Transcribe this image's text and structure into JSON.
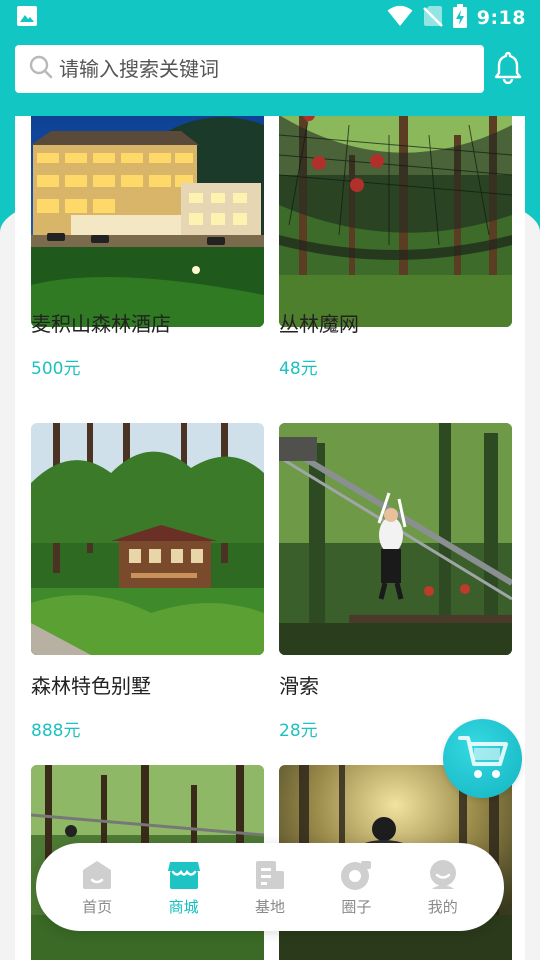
{
  "colors": {
    "accent": "#11c6c3",
    "price": "#1ec1c0",
    "inactive_nav": "#c9c9c9"
  },
  "status_bar": {
    "time": "9:18",
    "icons": [
      "gallery-icon",
      "wifi-icon",
      "no-sim-icon",
      "battery-charging-icon"
    ]
  },
  "search": {
    "placeholder": "请输入搜索关键词",
    "icon": "search-icon"
  },
  "header": {
    "notification_icon": "bell-icon"
  },
  "products": [
    {
      "name": "麦积山森林酒店",
      "price": "500元",
      "image": "forest-hotel-photo"
    },
    {
      "name": "丛林魔网",
      "price": "48元",
      "image": "jungle-net-photo"
    },
    {
      "name": "森林特色别墅",
      "price": "888元",
      "image": "forest-villa-photo"
    },
    {
      "name": "滑索",
      "price": "28元",
      "image": "zipline-photo"
    },
    {
      "name": "",
      "price": "",
      "image": "forest-zipline-photo"
    },
    {
      "name": "",
      "price": "",
      "image": "forest-cyclist-photo"
    }
  ],
  "cart": {
    "icon": "cart-icon"
  },
  "nav": {
    "items": [
      {
        "label": "首页",
        "icon": "home-icon",
        "active": false
      },
      {
        "label": "商城",
        "icon": "shop-icon",
        "active": true
      },
      {
        "label": "基地",
        "icon": "base-icon",
        "active": false
      },
      {
        "label": "圈子",
        "icon": "circle-icon",
        "active": false
      },
      {
        "label": "我的",
        "icon": "profile-icon",
        "active": false
      }
    ]
  }
}
